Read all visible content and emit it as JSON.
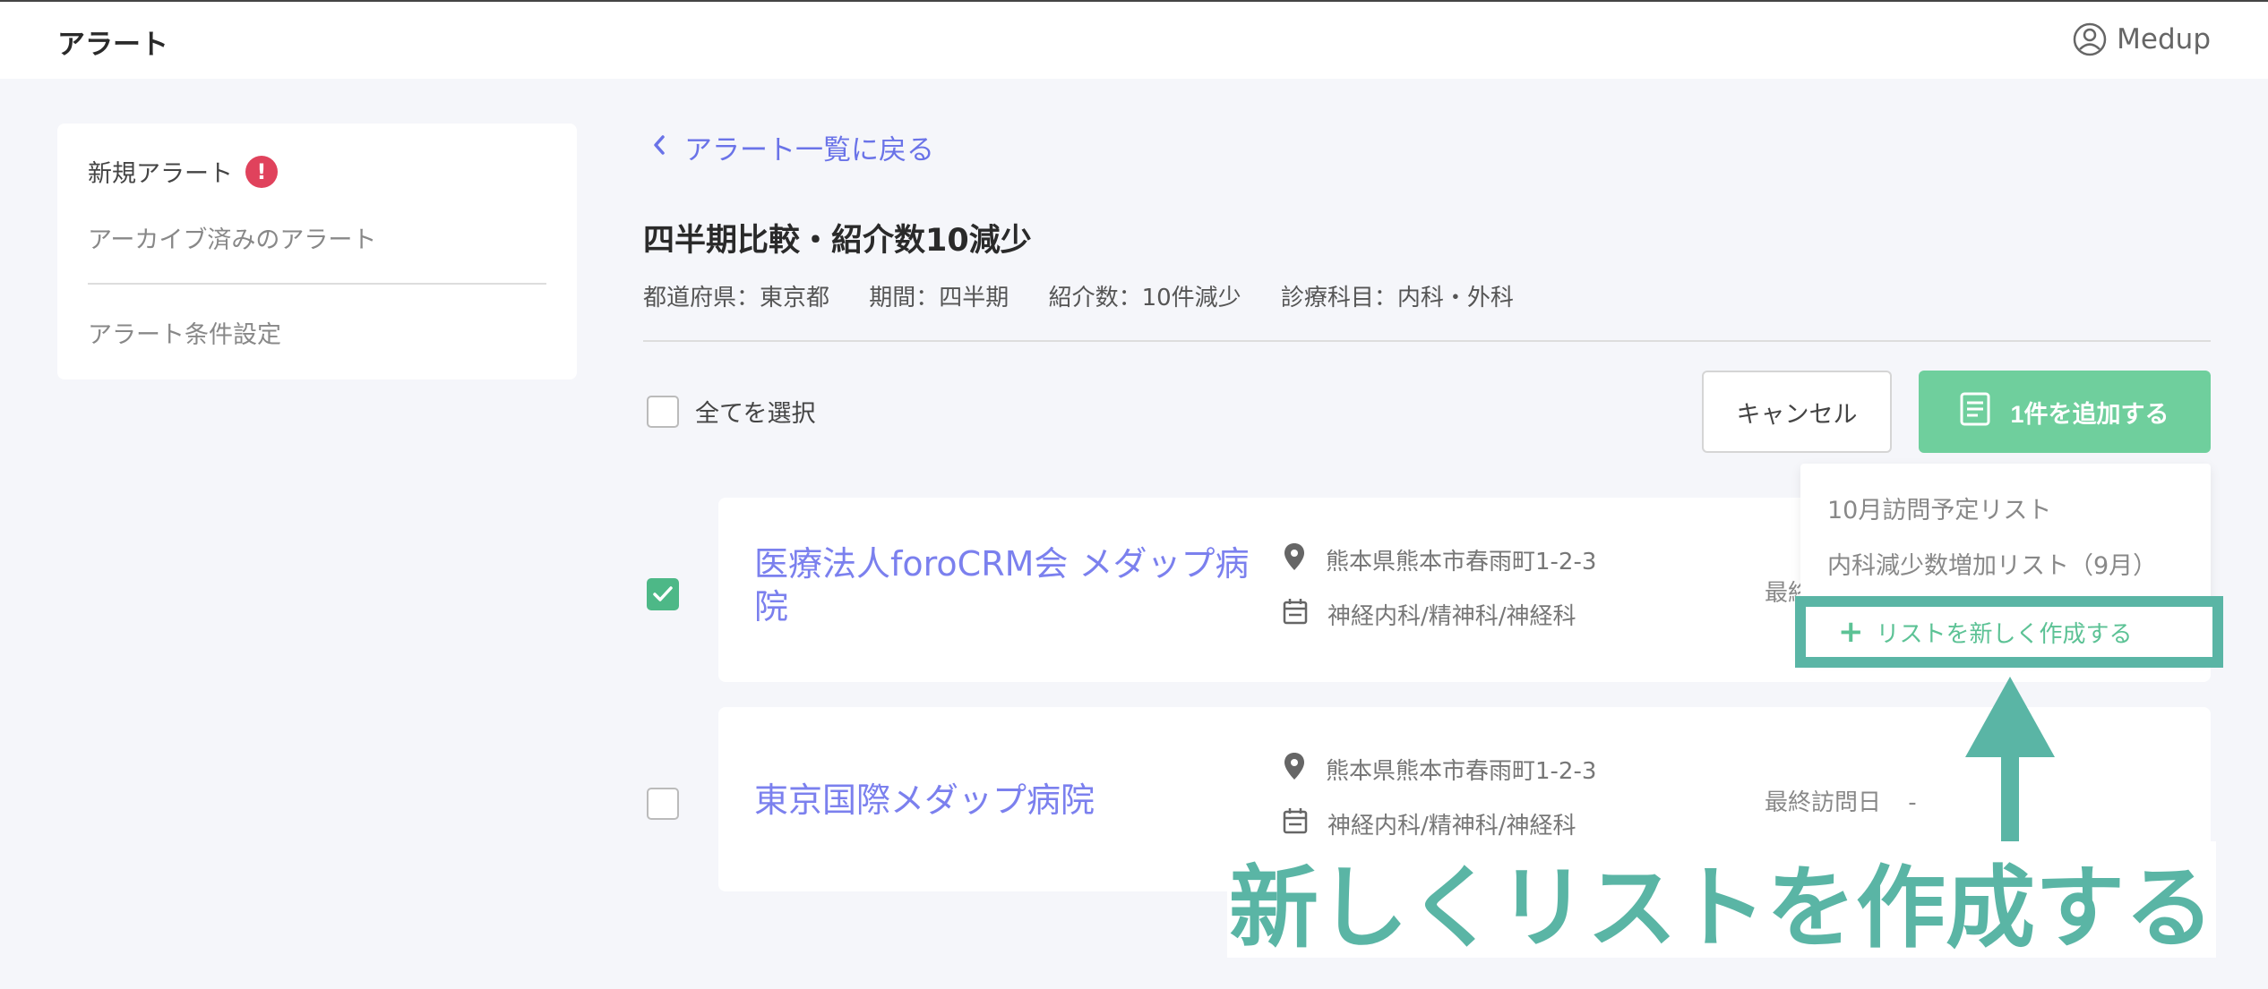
{
  "header": {
    "title": "アラート",
    "user_name": "Medup"
  },
  "sidebar": {
    "new_alert": "新規アラート",
    "new_alert_badge": "!",
    "archived": "アーカイブ済みのアラート",
    "settings": "アラート条件設定"
  },
  "main": {
    "back_link": "アラート一覧に戻る",
    "title": "四半期比較・紹介数10減少",
    "filters": [
      "都道府県：東京都",
      "期間：四半期",
      "紹介数：10件減少",
      "診療科目：内科・外科"
    ],
    "select_all": "全てを選択",
    "cancel_button": "キャンセル",
    "add_button": "1件を追加する"
  },
  "dropdown": {
    "items": [
      "10月訪問予定リスト",
      "内科減少数増加リスト（9月）"
    ],
    "create_new": "リストを新しく作成する"
  },
  "hospitals": [
    {
      "name": "医療法人foroCRM会 メダップ病院",
      "address": "熊本県熊本市春雨町1-2-3",
      "departments": "神経内科/精神科/神経科",
      "last_visit_label": "最終訪問日",
      "last_visit_value": "",
      "checked": true
    },
    {
      "name": "東京国際メダップ病院",
      "address": "熊本県熊本市春雨町1-2-3",
      "departments": "神経内科/精神科/神経科",
      "last_visit_label": "最終訪問日",
      "last_visit_value": "-",
      "checked": false
    }
  ],
  "annotation": {
    "text": "新しくリストを作成する"
  },
  "colors": {
    "accent_green": "#6fcf9d",
    "link_purple": "#6a73e8",
    "annotation_teal": "#5ab5a5",
    "badge_red": "#e0425c"
  }
}
